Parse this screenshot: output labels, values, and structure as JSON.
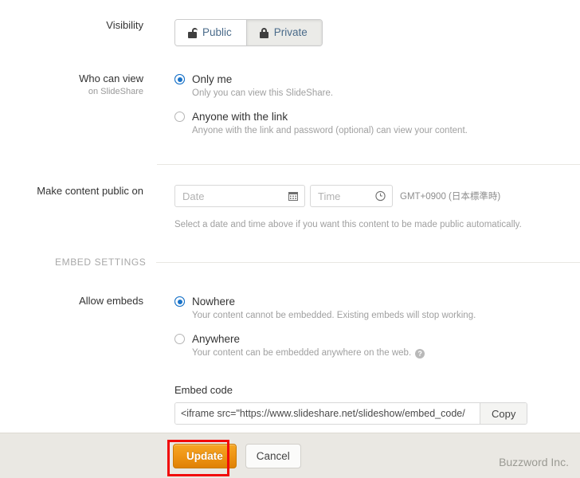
{
  "visibility": {
    "label": "Visibility",
    "options": [
      {
        "label": "Public",
        "icon": "unlock-icon",
        "active": false
      },
      {
        "label": "Private",
        "icon": "lock-icon",
        "active": true
      }
    ]
  },
  "who_can_view": {
    "label": "Who can view",
    "sublabel": "on SlideShare",
    "options": [
      {
        "label": "Only me",
        "help": "Only you can view this SlideShare.",
        "selected": true
      },
      {
        "label": "Anyone with the link",
        "help": "Anyone with the link and password (optional) can view your content.",
        "selected": false
      }
    ]
  },
  "make_public": {
    "label": "Make content public on",
    "date_placeholder": "Date",
    "date_value": "",
    "time_placeholder": "Time",
    "time_value": "",
    "timezone": "GMT+0900 (日本標準時)",
    "hint": "Select a date and time above if you want this content to be made public automatically.",
    "date_icon": "calendar-icon",
    "time_icon": "clock-icon"
  },
  "embed_section": {
    "title": "EMBED SETTINGS",
    "allow_embeds_label": "Allow embeds",
    "options": [
      {
        "label": "Nowhere",
        "help": "Your content cannot be embedded. Existing embeds will stop working.",
        "selected": true,
        "has_help_icon": false
      },
      {
        "label": "Anywhere",
        "help": "Your content can be embedded anywhere on the web.",
        "selected": false,
        "has_help_icon": true
      }
    ],
    "embed_code_label": "Embed code",
    "embed_code_value": "<iframe src=\"https://www.slideshare.net/slideshow/embed_code/",
    "copy_label": "Copy"
  },
  "footer": {
    "update_label": "Update",
    "cancel_label": "Cancel",
    "watermark": "Buzzword Inc."
  },
  "colors": {
    "accent_orange": "#ef9515",
    "radio_blue": "#1a73c8",
    "annotation_red": "#f10a0a",
    "footer_bg": "#eae8e3"
  }
}
